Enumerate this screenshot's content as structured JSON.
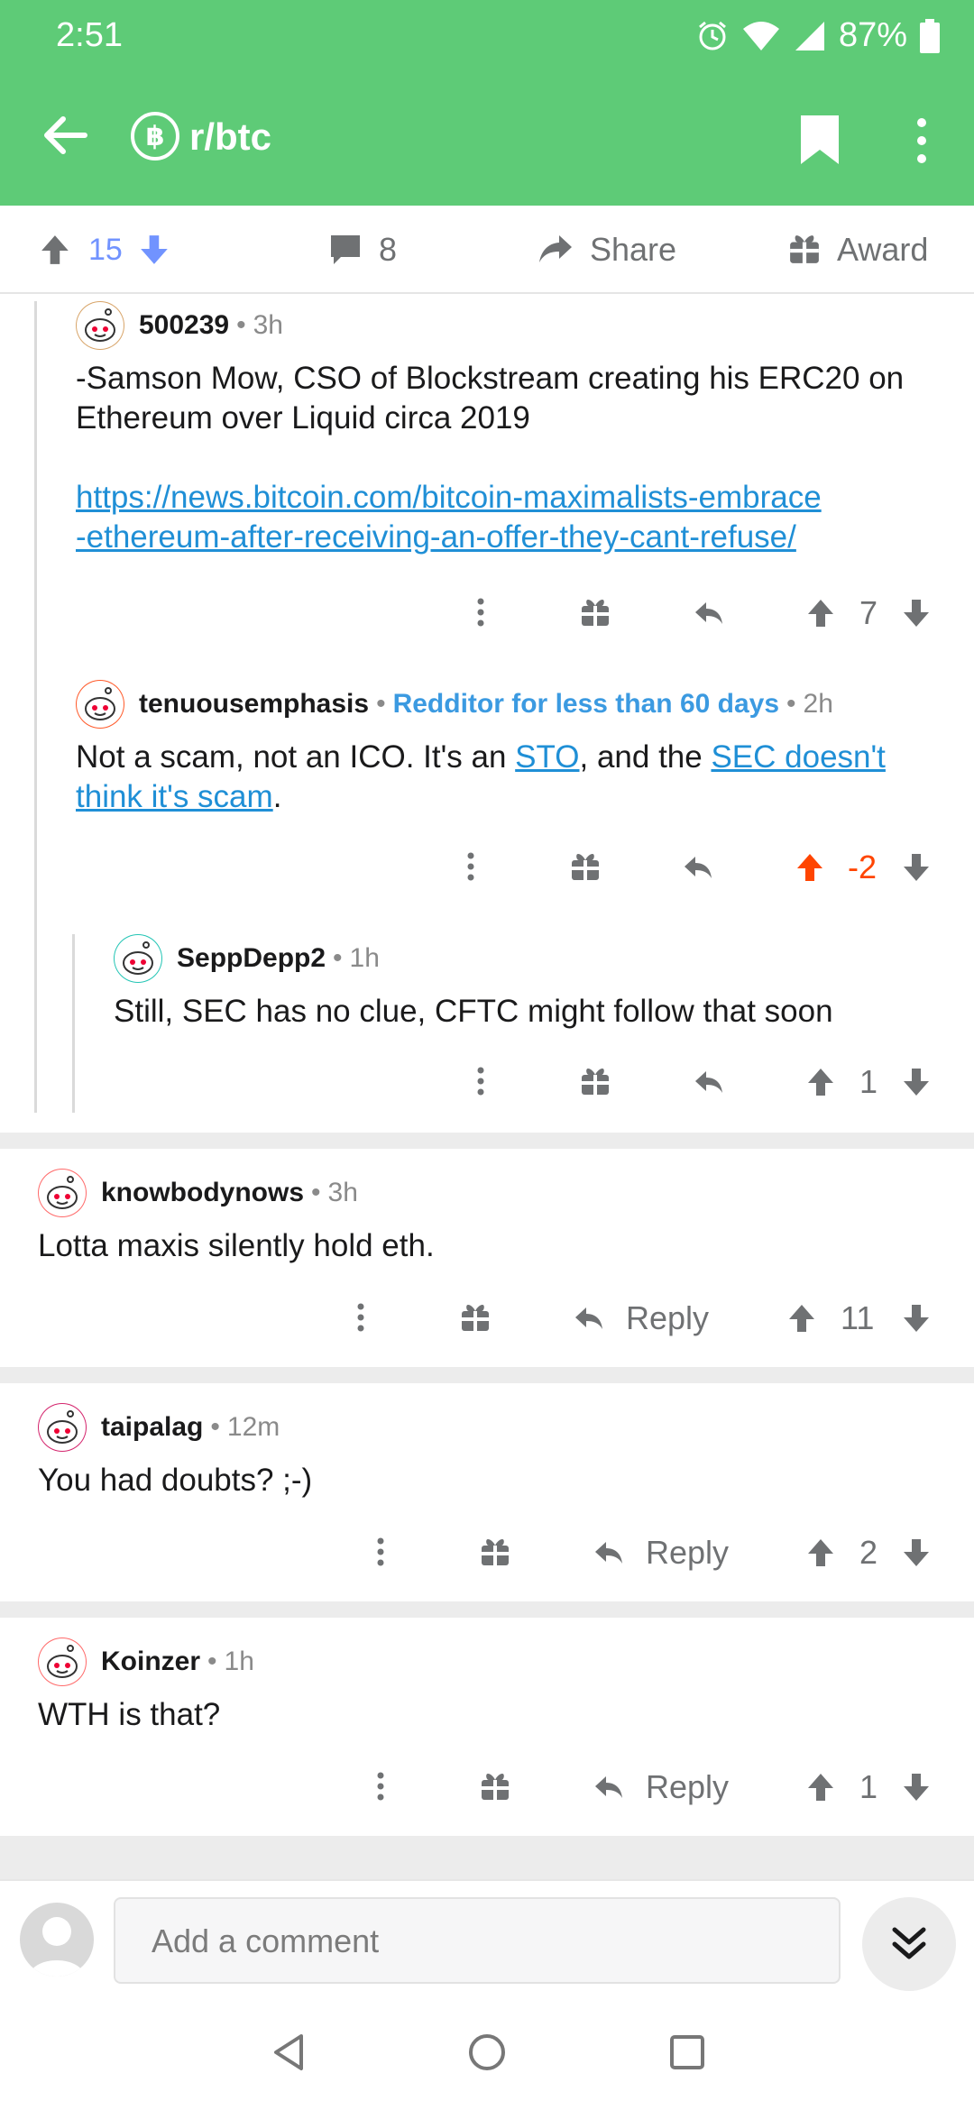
{
  "status": {
    "time": "2:51",
    "battery": "87%",
    "icons": [
      "alarm-icon",
      "wifi-icon",
      "signal-icon",
      "battery-icon"
    ]
  },
  "appbar": {
    "subreddit": "r/btc",
    "sub_icon_letter": "฿"
  },
  "post_actions": {
    "upvotes": "15",
    "comments": "8",
    "share": "Share",
    "award": "Award"
  },
  "comments": [
    {
      "user": "500239",
      "time": "3h",
      "text": "-Samson Mow, CSO of Blockstream creating his ERC20 on Ethereum over Liquid circa 2019",
      "link_line1": "https://news.bitcoin.com/bitcoin-maximalists-embrace",
      "link_line2": "-ethereum-after-receiving-an-offer-they-cant-refuse/",
      "score": "7"
    },
    {
      "user": "tenuousemphasis",
      "flair": "Redditor for less than 60 days",
      "time": "2h",
      "text_a": "Not a scam, not an ICO. It's an ",
      "link_a": "STO",
      "text_b": ", and the ",
      "link_b1": "SEC doesn't",
      "link_b2": "think it's scam",
      "text_c": ".",
      "score": "-2"
    },
    {
      "user": "SeppDepp2",
      "time": "1h",
      "text": "Still, SEC has no clue, CFTC might follow that soon",
      "score": "1"
    },
    {
      "user": "knowbodynows",
      "time": "3h",
      "text": "Lotta maxis silently hold eth.",
      "reply": "Reply",
      "score": "11"
    },
    {
      "user": "taipalag",
      "time": "12m",
      "text": "You had doubts? ;-)",
      "reply": "Reply",
      "score": "2"
    },
    {
      "user": "Koinzer",
      "time": "1h",
      "text": "WTH is that?",
      "reply": "Reply",
      "score": "1"
    }
  ],
  "composer": {
    "placeholder": "Add a comment"
  },
  "colors": {
    "brand": "#5ECB77",
    "upvote_active": "#FF4500",
    "vote_blue": "#7193FF",
    "link": "#1F8FD6"
  }
}
